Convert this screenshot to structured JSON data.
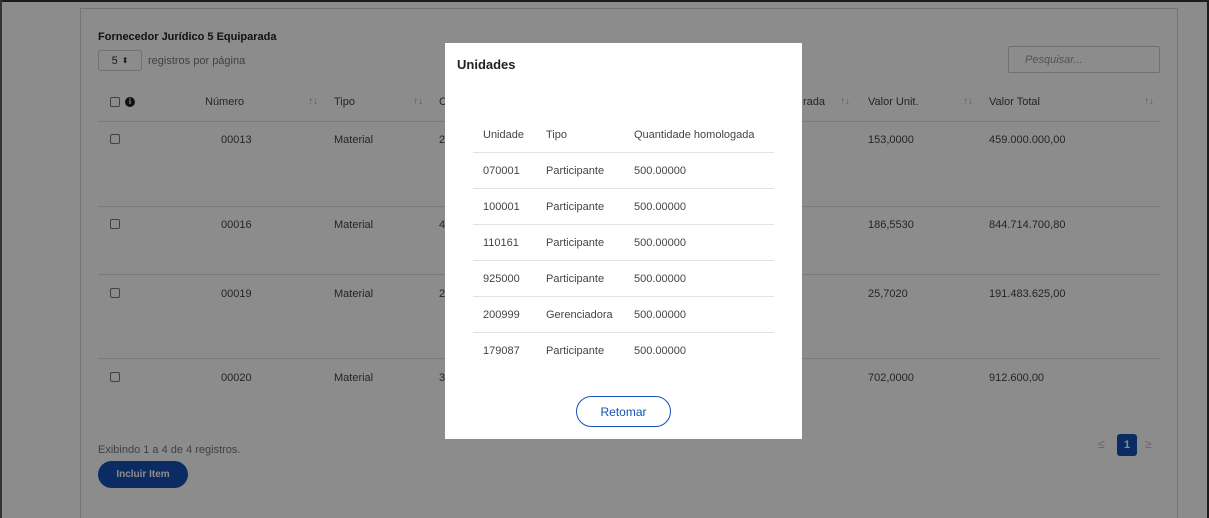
{
  "section": {
    "title": "Fornecedor Jurídico 5 Equiparada",
    "perpage_value": "5",
    "perpage_label": "registros por página"
  },
  "search": {
    "placeholder": "Pesquisar..."
  },
  "table": {
    "headers": {
      "numero": "Número",
      "tipo": "Tipo",
      "col_c": "C",
      "col_partial": "rada",
      "valor_unit": "Valor Unit.",
      "valor_total": "Valor Total"
    },
    "sort_icon": "↑↓",
    "rows": [
      {
        "numero": "00013",
        "tipo": "Material",
        "col_c": "2",
        "valor_unit": "153,0000",
        "valor_total": "459.000.000,00"
      },
      {
        "numero": "00016",
        "tipo": "Material",
        "col_c": "4",
        "valor_unit": "186,5530",
        "valor_total": "844.714.700,80"
      },
      {
        "numero": "00019",
        "tipo": "Material",
        "col_c": "2",
        "valor_unit": "25,7020",
        "valor_total": "191.483.625,00"
      },
      {
        "numero": "00020",
        "tipo": "Material",
        "col_c": "3",
        "valor_unit": "702,0000",
        "valor_total": "912.600,00"
      }
    ]
  },
  "footer": {
    "summary": "Exibindo 1 a 4 de 4 registros.",
    "include_label": "Incluir Item"
  },
  "pagination": {
    "prev": "≤",
    "current": "1",
    "next": "≥"
  },
  "modal": {
    "title": "Unidades",
    "headers": {
      "unidade": "Unidade",
      "tipo": "Tipo",
      "quantidade": "Quantidade homologada"
    },
    "rows": [
      {
        "unidade": "070001",
        "tipo": "Participante",
        "quantidade": "500.00000"
      },
      {
        "unidade": "100001",
        "tipo": "Participante",
        "quantidade": "500.00000"
      },
      {
        "unidade": "110161",
        "tipo": "Participante",
        "quantidade": "500.00000"
      },
      {
        "unidade": "925000",
        "tipo": "Participante",
        "quantidade": "500.00000"
      },
      {
        "unidade": "200999",
        "tipo": "Gerenciadora",
        "quantidade": "500.00000"
      },
      {
        "unidade": "179087",
        "tipo": "Participante",
        "quantidade": "500.00000"
      }
    ],
    "button_label": "Retomar"
  },
  "colors": {
    "primary": "#1351b4",
    "overlay": "rgba(0,0,0,0.45)"
  },
  "icons": {
    "info": "info-circle-icon",
    "select_arrows": "select-arrows-icon",
    "sort": "sort-icon"
  }
}
